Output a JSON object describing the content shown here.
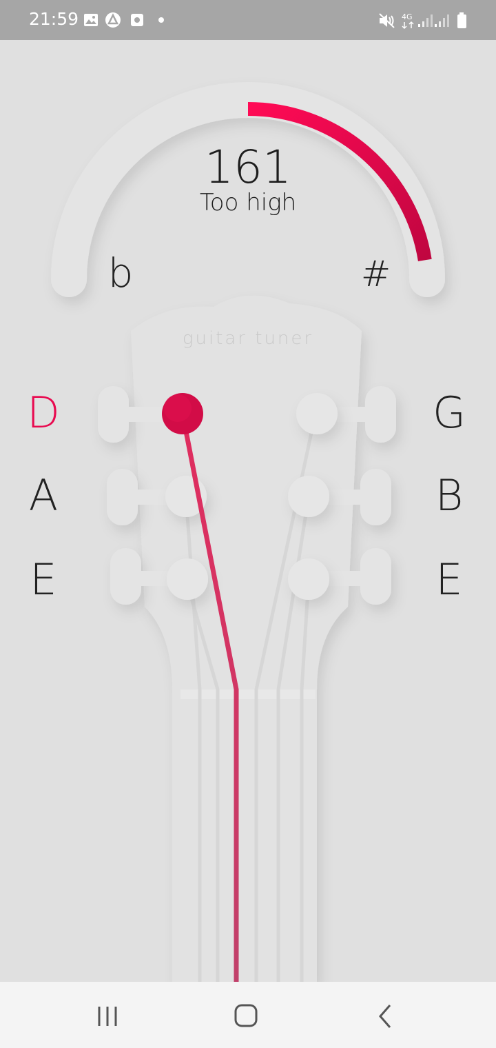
{
  "status_bar": {
    "time": "21:59",
    "left_icons": [
      "gallery-icon",
      "app-icon",
      "media-icon",
      "notification-dot-icon"
    ],
    "right_icons": [
      "mute-icon",
      "4g-icon",
      "signal-icon",
      "signal-icon",
      "battery-icon"
    ],
    "network_label": "4G"
  },
  "tuner": {
    "value": "161",
    "status": "Too high",
    "flat_symbol": "b",
    "sharp_symbol": "#",
    "deviation_fraction": 0.9,
    "accent_color": "#e8094f"
  },
  "headstock": {
    "logo_text": "guitar tuner"
  },
  "strings": {
    "left": [
      {
        "note": "D",
        "active": true
      },
      {
        "note": "A",
        "active": false
      },
      {
        "note": "E",
        "active": false
      }
    ],
    "right": [
      {
        "note": "G",
        "active": false
      },
      {
        "note": "B",
        "active": false
      },
      {
        "note": "E",
        "active": false
      }
    ]
  },
  "nav_bar": {
    "buttons": [
      "recent-apps-icon",
      "home-icon",
      "back-icon"
    ]
  }
}
